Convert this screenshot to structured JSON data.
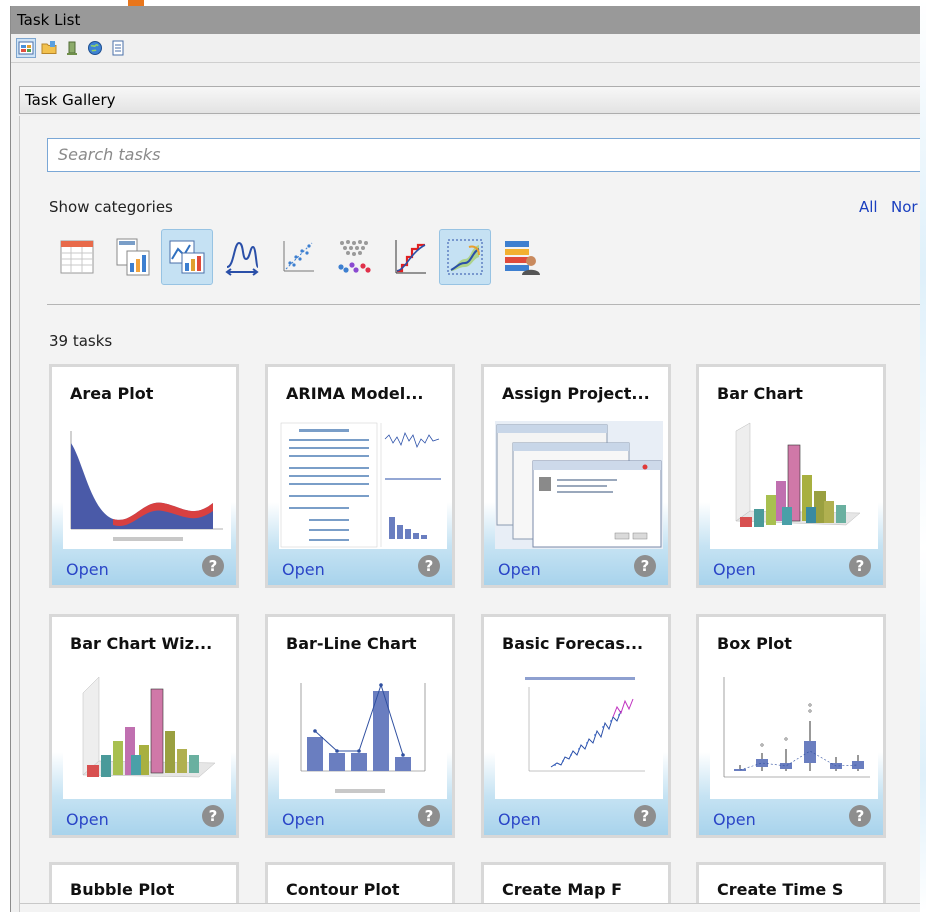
{
  "window": {
    "title": "Task List"
  },
  "toolbar": {
    "buttons": [
      {
        "icon": "task-gallery-icon",
        "active": true
      },
      {
        "icon": "folder-icon",
        "active": false
      },
      {
        "icon": "database-icon",
        "active": false
      },
      {
        "icon": "globe-icon",
        "active": false
      },
      {
        "icon": "list-icon",
        "active": false
      }
    ]
  },
  "gallery": {
    "header": "Task Gallery",
    "search_placeholder": "Search tasks",
    "show_categories": "Show categories",
    "all_label": "All",
    "none_label": "Nor",
    "categories": [
      {
        "icon": "table-icon",
        "selected": false
      },
      {
        "icon": "report-icon",
        "selected": false
      },
      {
        "icon": "graph-icon",
        "selected": true
      },
      {
        "icon": "distribution-icon",
        "selected": false
      },
      {
        "icon": "scatter-icon",
        "selected": false
      },
      {
        "icon": "clustering-icon",
        "selected": false
      },
      {
        "icon": "cumulative-icon",
        "selected": false
      },
      {
        "icon": "forecast-icon",
        "selected": true
      },
      {
        "icon": "data-user-icon",
        "selected": false
      }
    ],
    "task_count": "39 tasks"
  },
  "tasks": [
    {
      "title": "Area Plot",
      "open": "Open",
      "help": "?",
      "thumbnail": "area-plot-thumbnail"
    },
    {
      "title": "ARIMA Model...",
      "open": "Open",
      "help": "?",
      "thumbnail": "arima-thumbnail"
    },
    {
      "title": "Assign Project...",
      "open": "Open",
      "help": "?",
      "thumbnail": "assign-project-thumbnail"
    },
    {
      "title": "Bar Chart",
      "open": "Open",
      "help": "?",
      "thumbnail": "bar-chart-thumbnail"
    },
    {
      "title": "Bar Chart Wiz...",
      "open": "Open",
      "help": "?",
      "thumbnail": "bar-chart-wizard-thumbnail"
    },
    {
      "title": "Bar-Line Chart",
      "open": "Open",
      "help": "?",
      "thumbnail": "bar-line-thumbnail"
    },
    {
      "title": "Basic Forecas...",
      "open": "Open",
      "help": "?",
      "thumbnail": "forecast-thumbnail"
    },
    {
      "title": "Box Plot",
      "open": "Open",
      "help": "?",
      "thumbnail": "box-plot-thumbnail"
    }
  ],
  "partial_tasks": [
    {
      "title": "Bubble Plot"
    },
    {
      "title": "Contour Plot"
    },
    {
      "title": "Create Map F"
    },
    {
      "title": "Create Time S"
    }
  ],
  "colors": {
    "link": "#2a45c7",
    "title_bar": "#999999",
    "accent": "#e8761c",
    "selected_category": "#c5e1f3"
  }
}
